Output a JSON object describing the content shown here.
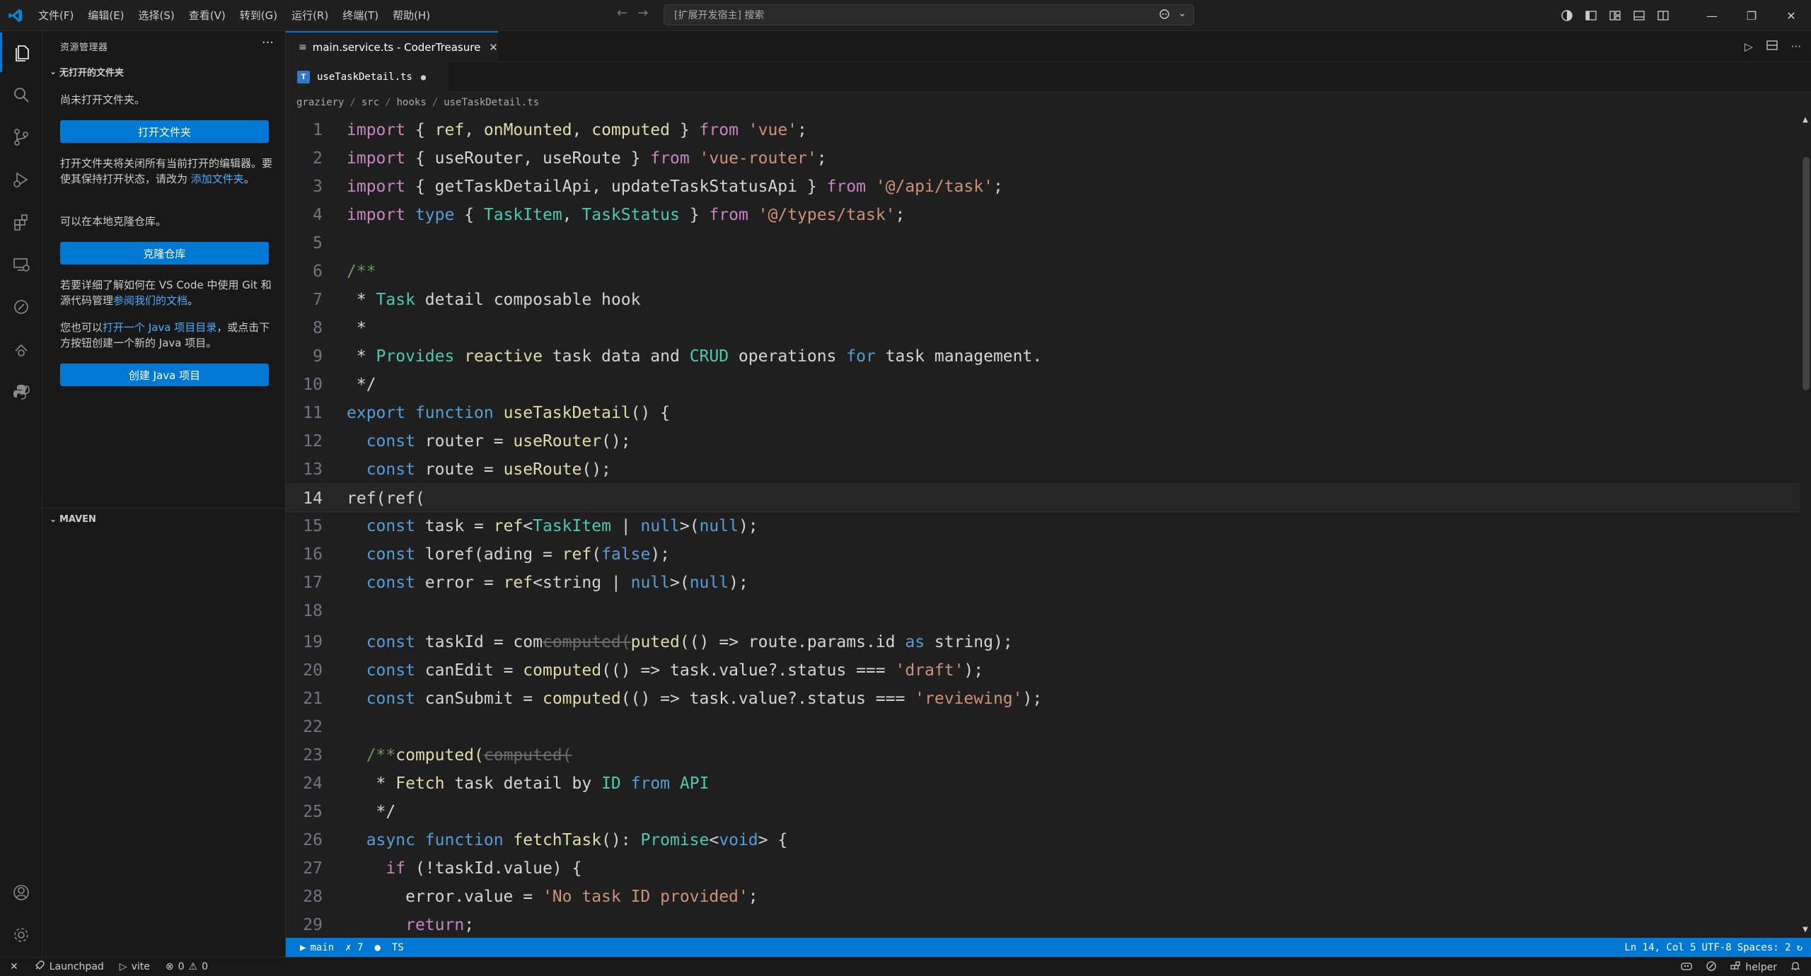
{
  "menu": [
    "文件(F)",
    "编辑(E)",
    "选择(S)",
    "查看(V)",
    "转到(G)",
    "运行(R)",
    "终端(T)",
    "帮助(H)"
  ],
  "search": {
    "text": "[扩展开发宿主] 搜索"
  },
  "sidebar": {
    "title": "资源管理器",
    "more": "···",
    "section_no_folder": "无打开的文件夹",
    "text_not_opened": "尚未打开文件夹。",
    "btn_open_folder": "打开文件夹",
    "text_open_note_1": "打开文件夹将关闭所有当前打开的编辑器。要使其保持打开状态，请改为 ",
    "link_add_folder": "添加文件夹",
    "text_open_note_2": "。",
    "text_clone": "可以在本地克隆仓库。",
    "btn_clone": "克隆仓库",
    "text_git_1": "若要详细了解如何在 VS Code 中使用 Git 和源代码管理",
    "link_docs": "参阅我们的文档",
    "text_git_2": "。",
    "text_java_1": "您也可以",
    "link_java_dir": "打开一个 Java 项目目录",
    "text_java_2": "，或点击下方按钮创建一个新的 Java 项目。",
    "btn_java": "创建 Java 项目",
    "section_maven": "MAVEN"
  },
  "editor": {
    "tab_group1": "main.service.ts - CoderTreasure",
    "tab_active": "useTaskDetail.ts",
    "tab_badge": "T",
    "breadcrumb": [
      "graziery",
      "src",
      "hooks",
      "useTaskDetail.ts"
    ]
  },
  "code_lines": [
    {
      "n": "1",
      "y": 0,
      "t": [
        [
          "kc",
          "import "
        ],
        [
          "pu",
          "{ "
        ],
        [
          "fn",
          "ref"
        ],
        [
          "pu",
          ", "
        ],
        [
          "fn",
          "onMounted"
        ],
        [
          "pu",
          ", "
        ],
        [
          "fn",
          "computed"
        ],
        [
          "pu",
          " } "
        ],
        [
          "kc",
          "from "
        ],
        [
          "st",
          "'vue'"
        ],
        [
          "pu",
          ";"
        ]
      ]
    },
    {
      "n": "2",
      "y": 1,
      "t": [
        [
          "kc",
          "import "
        ],
        [
          "pu",
          "{ useRouter, useRoute } "
        ],
        [
          "kc",
          "from "
        ],
        [
          "st",
          "'vue-router'"
        ],
        [
          "pu",
          ";"
        ]
      ]
    },
    {
      "n": "3",
      "y": 2,
      "t": [
        [
          "kc",
          "import "
        ],
        [
          "pu",
          "{ getTaskDetailApi, updateTaskStatusApi } "
        ],
        [
          "kc",
          "from "
        ],
        [
          "st",
          "'@/api/task'"
        ],
        [
          "pu",
          ";"
        ]
      ]
    },
    {
      "n": "4",
      "y": 3,
      "t": [
        [
          "kc",
          "import "
        ],
        [
          "kw",
          "type "
        ],
        [
          "pu",
          "{ "
        ],
        [
          "tp",
          "TaskItem"
        ],
        [
          "pu",
          ", "
        ],
        [
          "tp",
          "TaskStatus"
        ],
        [
          "pu",
          " } "
        ],
        [
          "kc",
          "from "
        ],
        [
          "st",
          "'@/types/task'"
        ],
        [
          "pu",
          ";"
        ]
      ]
    },
    {
      "n": "5",
      "y": 4,
      "t": []
    },
    {
      "n": "6",
      "y": 5,
      "t": [
        [
          "cm",
          "/**"
        ]
      ]
    },
    {
      "n": "7",
      "y": 6,
      "t": [
        [
          "pu",
          " * "
        ],
        [
          "tp",
          "Task"
        ],
        [
          "pu",
          " detail composable hook"
        ]
      ]
    },
    {
      "n": "8",
      "y": 7,
      "t": [
        [
          "pu",
          " *"
        ]
      ]
    },
    {
      "n": "9",
      "y": 8,
      "t": [
        [
          "pu",
          " * "
        ],
        [
          "tp",
          "Provides"
        ],
        [
          "pu",
          " "
        ],
        [
          "fn",
          "reactive"
        ],
        [
          "pu",
          " task data and "
        ],
        [
          "tp",
          "CRUD"
        ],
        [
          "pu",
          " operations "
        ],
        [
          "kw",
          "for"
        ],
        [
          "pu",
          " task management."
        ]
      ]
    },
    {
      "n": "10",
      "y": 9,
      "t": [
        [
          "pu",
          " */"
        ]
      ]
    },
    {
      "n": "11",
      "y": 10,
      "t": [
        [
          "kw",
          "export "
        ],
        [
          "kw",
          "function "
        ],
        [
          "fn",
          "useTaskDetail"
        ],
        [
          "pu",
          "() {"
        ]
      ]
    },
    {
      "n": "12",
      "y": 11,
      "t": [
        [
          "pu",
          "  "
        ],
        [
          "kw",
          "const "
        ],
        [
          "pu",
          "router = "
        ],
        [
          "fn",
          "useRouter"
        ],
        [
          "pu",
          "();"
        ]
      ]
    },
    {
      "n": "13",
      "y": 12,
      "t": [
        [
          "pu",
          "  "
        ],
        [
          "kw",
          "const "
        ],
        [
          "pu",
          "route = "
        ],
        [
          "fn",
          "useRoute"
        ],
        [
          "pu",
          "();"
        ]
      ]
    },
    {
      "n": "14",
      "y": 13,
      "cur": true,
      "t": [
        [
          "pu",
          "ref(ref("
        ]
      ]
    },
    {
      "n": "15",
      "y": 14,
      "t": [
        [
          "pu",
          "  "
        ],
        [
          "kw",
          "const "
        ],
        [
          "pu",
          "task = "
        ],
        [
          "fn",
          "ref"
        ],
        [
          "pu",
          "<"
        ],
        [
          "tp",
          "TaskItem"
        ],
        [
          "pu",
          " | "
        ],
        [
          "kw",
          "null"
        ],
        [
          "pu",
          ">("
        ],
        [
          "kw",
          "null"
        ],
        [
          "pu",
          ");"
        ]
      ]
    },
    {
      "n": "16",
      "y": 15,
      "t": [
        [
          "pu",
          "  "
        ],
        [
          "kw",
          "const "
        ],
        [
          "pu",
          "loref(ading = "
        ],
        [
          "fn",
          "ref"
        ],
        [
          "pu",
          "("
        ],
        [
          "kw",
          "false"
        ],
        [
          "pu",
          ");"
        ]
      ]
    },
    {
      "n": "17",
      "y": 16,
      "t": [
        [
          "pu",
          "  "
        ],
        [
          "kw",
          "const "
        ],
        [
          "pu",
          "error = "
        ],
        [
          "fn",
          "ref"
        ],
        [
          "pu",
          "<string | "
        ],
        [
          "kw",
          "null"
        ],
        [
          "pu",
          ">("
        ],
        [
          "kw",
          "null"
        ],
        [
          "pu",
          ");"
        ]
      ]
    },
    {
      "n": "18",
      "y": 17,
      "t": []
    },
    {
      "n": "19",
      "y": 18,
      "t": [
        [
          "pu",
          "  "
        ],
        [
          "kw",
          "const "
        ],
        [
          "pu",
          "taskId = com"
        ],
        [
          "gh",
          "computed("
        ],
        [
          "fn",
          "puted"
        ],
        [
          "pu",
          "(() => route.params.id "
        ],
        [
          "kw",
          "as"
        ],
        [
          "pu",
          " string);"
        ]
      ]
    },
    {
      "n": "20",
      "y": 19,
      "t": [
        [
          "pu",
          "  "
        ],
        [
          "kw",
          "const "
        ],
        [
          "pu",
          "canEdit = "
        ],
        [
          "fn",
          "computed"
        ],
        [
          "pu",
          "(() => task.value?.status === "
        ],
        [
          "st",
          "'draft'"
        ],
        [
          "pu",
          ");"
        ]
      ]
    },
    {
      "n": "21",
      "y": 20,
      "t": [
        [
          "pu",
          "  "
        ],
        [
          "kw",
          "const "
        ],
        [
          "pu",
          "canSubmit = "
        ],
        [
          "fn",
          "computed"
        ],
        [
          "pu",
          "(() => task.value?.status === "
        ],
        [
          "st",
          "'reviewing'"
        ],
        [
          "pu",
          ");"
        ]
      ]
    },
    {
      "n": "22",
      "y": 21,
      "t": []
    },
    {
      "n": "23",
      "y": 22,
      "t": [
        [
          "pu",
          "  "
        ],
        [
          "cm",
          "/**"
        ],
        [
          "fn",
          "computed("
        ],
        [
          "gh",
          "computed("
        ]
      ]
    },
    {
      "n": "24",
      "y": 23,
      "t": [
        [
          "pu",
          "   * "
        ],
        [
          "fn",
          "Fetch"
        ],
        [
          "pu",
          " task detail by "
        ],
        [
          "tp",
          "ID"
        ],
        [
          "pu",
          " "
        ],
        [
          "kw",
          "from"
        ],
        [
          "pu",
          " "
        ],
        [
          "tp",
          "API"
        ]
      ]
    },
    {
      "n": "25",
      "y": 24,
      "t": [
        [
          "pu",
          "   */"
        ]
      ]
    },
    {
      "n": "26",
      "y": 25,
      "t": [
        [
          "pu",
          "  "
        ],
        [
          "kw",
          "async "
        ],
        [
          "kw",
          "function "
        ],
        [
          "fn",
          "fetchTask"
        ],
        [
          "pu",
          "(): "
        ],
        [
          "tp",
          "Promise"
        ],
        [
          "pu",
          "<"
        ],
        [
          "kw",
          "void"
        ],
        [
          "pu",
          "> {"
        ]
      ]
    },
    {
      "n": "27",
      "y": 26,
      "t": [
        [
          "pu",
          "    "
        ],
        [
          "kc",
          "if "
        ],
        [
          "pu",
          "(!taskId.value) {"
        ]
      ]
    },
    {
      "n": "28",
      "y": 27,
      "t": [
        [
          "pu",
          "      error.value = "
        ],
        [
          "st",
          "'No task ID provided'"
        ],
        [
          "pu",
          ";"
        ]
      ]
    },
    {
      "n": "29",
      "y": 28,
      "t": [
        [
          "pu",
          "      "
        ],
        [
          "kc",
          "return"
        ],
        [
          "pu",
          ";"
        ]
      ]
    }
  ],
  "status": {
    "branch": "main",
    "errors_x": "✗ 7",
    "lang": "TS",
    "position": "Ln 14, Col 5",
    "encoding": "UTF-8",
    "spaces": "Spaces: 2"
  },
  "bottom": {
    "launchpad": "Launchpad",
    "vite": "vite",
    "problems_err": "0",
    "problems_warn": "0",
    "helper": "helper"
  },
  "colors": {
    "accent": "#0078d4",
    "link": "#4daafc"
  }
}
